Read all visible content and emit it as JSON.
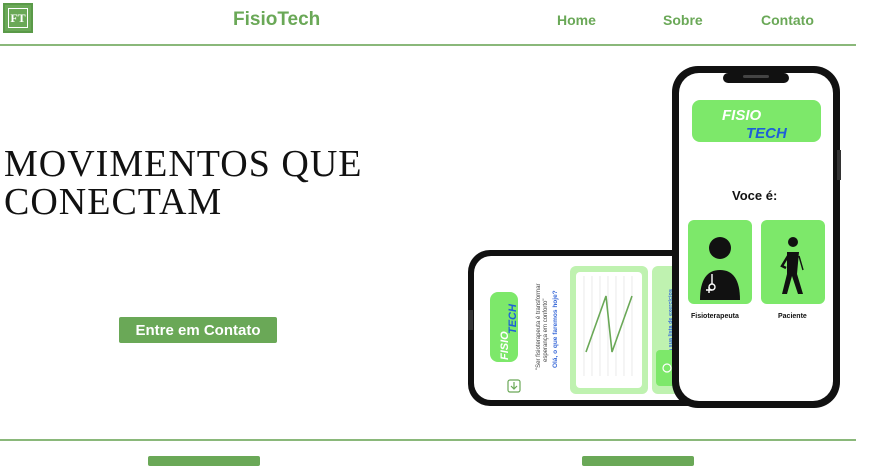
{
  "logo": {
    "text": "FT"
  },
  "brand": "FisioTech",
  "nav": {
    "items": [
      "Home",
      "Sobre",
      "Contato"
    ]
  },
  "hero": {
    "title_line1": "MOVIMENTOS QUE",
    "title_line2": "CONECTAM",
    "cta_label": "Entre em Contato"
  },
  "phone_front": {
    "logo_line1": "FISIO",
    "logo_line2": "TECH",
    "question": "Voce é:",
    "option_1": "Fisioterapeuta",
    "option_2": "Paciente"
  },
  "phone_back": {
    "logo_line1": "FISIO",
    "logo_line2": "TECH",
    "text_1": "\"Ser fisioterapeuta é transformar",
    "text_2": "esperança em conforto\"",
    "text_3": "Olá, o que faremos hoje?",
    "side_text": "Veja sua lista de exercícios"
  },
  "colors": {
    "accent": "#6aa857",
    "phone_green": "#7de86a",
    "logo_blue": "#1e5fd8",
    "divider": "#8ab87a"
  }
}
